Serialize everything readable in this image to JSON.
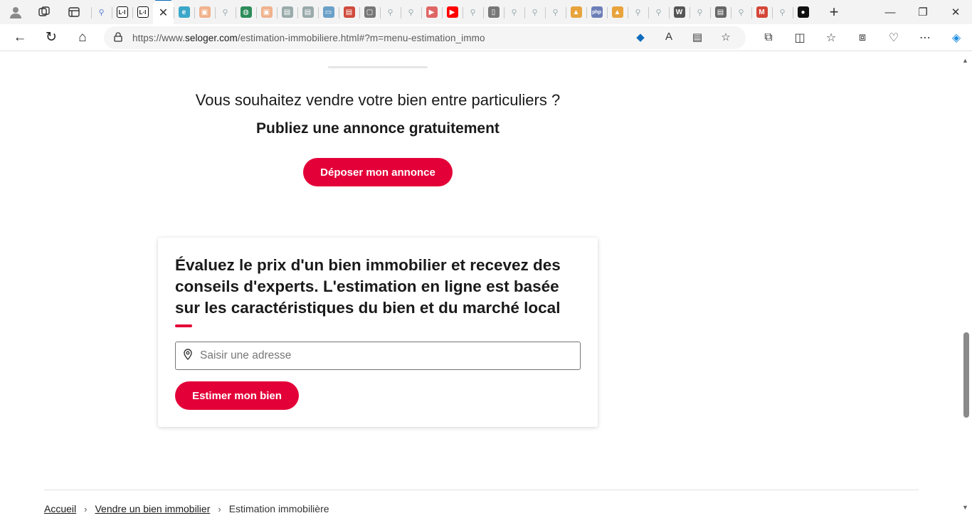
{
  "browser": {
    "url_prefix": "https://www.",
    "url_domain": "seloger.com",
    "url_path": "/estimation-immobiliere.html#?m=menu-estimation_immo",
    "accent": "#0f6cbd",
    "tabs": [
      {
        "icon": "search-icon",
        "color": "#5b7fd6",
        "glyph": "⚲"
      },
      {
        "icon": "li-icon",
        "color": "#111111",
        "glyph": "L·I"
      },
      {
        "icon": "li-icon",
        "color": "#111111",
        "glyph": "L·I"
      },
      {
        "icon": "close-icon",
        "active": true,
        "glyph": "✕"
      },
      {
        "icon": "edge-icon",
        "color": "#3ba7c9",
        "glyph": "e"
      },
      {
        "icon": "image-icon",
        "color": "#f0b28c",
        "glyph": "▣"
      },
      {
        "icon": "search-icon",
        "color": "#9aa",
        "glyph": "⚲"
      },
      {
        "icon": "globe-icon",
        "color": "#2c8c5a",
        "glyph": "◍"
      },
      {
        "icon": "image-icon",
        "color": "#f0b28c",
        "glyph": "▣"
      },
      {
        "icon": "file-icon",
        "color": "#9aa",
        "glyph": "▤"
      },
      {
        "icon": "file-icon",
        "color": "#9aa",
        "glyph": "▤"
      },
      {
        "icon": "screen-icon",
        "color": "#6ba0c8",
        "glyph": "▭"
      },
      {
        "icon": "pdf-icon",
        "color": "#d04a3c",
        "glyph": "▤"
      },
      {
        "icon": "window-icon",
        "color": "#777",
        "glyph": "▢"
      },
      {
        "icon": "search-icon",
        "color": "#9aa",
        "glyph": "⚲"
      },
      {
        "icon": "search-icon",
        "color": "#9aa",
        "glyph": "⚲"
      },
      {
        "icon": "youtube-icon",
        "color": "#e06666",
        "glyph": "▶"
      },
      {
        "icon": "youtube-icon",
        "color": "#ff0000",
        "glyph": "▶"
      },
      {
        "icon": "search-icon",
        "color": "#9aa",
        "glyph": "⚲"
      },
      {
        "icon": "file-icon",
        "color": "#777",
        "glyph": "▯"
      },
      {
        "icon": "search-icon",
        "color": "#9aa",
        "glyph": "⚲"
      },
      {
        "icon": "search-icon",
        "color": "#9aa",
        "glyph": "⚲"
      },
      {
        "icon": "search-icon",
        "color": "#9aa",
        "glyph": "⚲"
      },
      {
        "icon": "pma-icon",
        "color": "#e8a33c",
        "glyph": "▲"
      },
      {
        "icon": "php-icon",
        "color": "#6c7eb7",
        "glyph": "php"
      },
      {
        "icon": "pma-icon",
        "color": "#e8a33c",
        "glyph": "▲"
      },
      {
        "icon": "search-icon",
        "color": "#9aa",
        "glyph": "⚲"
      },
      {
        "icon": "search-icon",
        "color": "#9aa",
        "glyph": "⚲"
      },
      {
        "icon": "wikipedia-icon",
        "color": "#555",
        "glyph": "W"
      },
      {
        "icon": "search-icon",
        "color": "#9aa",
        "glyph": "⚲"
      },
      {
        "icon": "lock-file-icon",
        "color": "#666",
        "glyph": "▤"
      },
      {
        "icon": "search-icon",
        "color": "#9aa",
        "glyph": "⚲"
      },
      {
        "icon": "gmail-icon",
        "color": "#d44638",
        "glyph": "M"
      },
      {
        "icon": "search-icon",
        "color": "#9aa",
        "glyph": "⚲"
      },
      {
        "icon": "github-icon",
        "color": "#111",
        "glyph": "●"
      }
    ]
  },
  "page": {
    "sell_question": "Vous souhaitez vendre votre bien entre particuliers ?",
    "sell_subtitle": "Publiez une annonce gratuitement",
    "deposer_button": "Déposer mon annonce",
    "card_title": "Évaluez le prix d'un bien immobilier et recevez des conseils d'experts. L'estimation en ligne est basée sur les caractéristiques du bien et du marché local",
    "address_placeholder": "Saisir une adresse",
    "estimer_button": "Estimer mon bien",
    "brand_color": "#e30038",
    "breadcrumb": {
      "home": "Accueil",
      "section": "Vendre un bien immobilier",
      "current": "Estimation immobilière"
    }
  }
}
